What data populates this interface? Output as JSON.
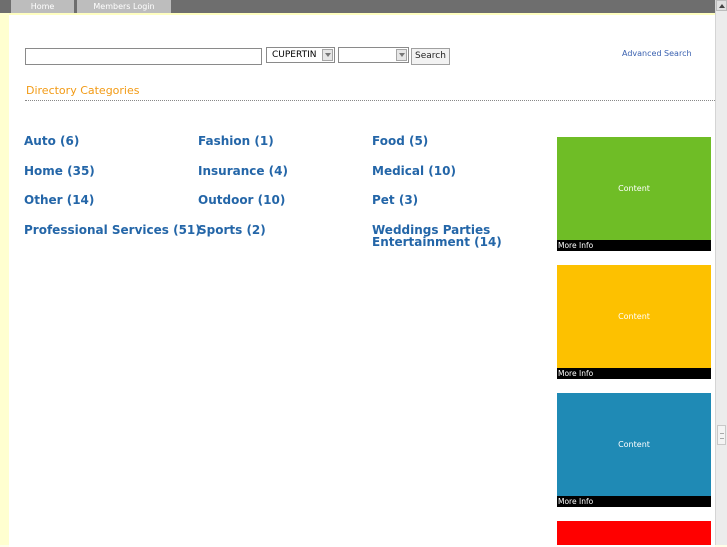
{
  "nav": {
    "tabs": [
      {
        "label": "Home"
      },
      {
        "label": "Members Login"
      }
    ]
  },
  "search": {
    "keyword_value": "",
    "city_value": "CUPERTIN",
    "category_value": "",
    "button_label": "Search",
    "advanced_label": "Advanced Search"
  },
  "directory": {
    "heading": "Directory Categories",
    "categories": [
      {
        "label": "Auto (6)"
      },
      {
        "label": "Fashion (1)"
      },
      {
        "label": "Food (5)"
      },
      {
        "label": "Home (35)"
      },
      {
        "label": "Insurance (4)"
      },
      {
        "label": "Medical (10)"
      },
      {
        "label": "Other (14)"
      },
      {
        "label": "Outdoor (10)"
      },
      {
        "label": "Pet (3)"
      },
      {
        "label": "Professional Services (51)"
      },
      {
        "label": "Sports (2)"
      },
      {
        "label": "Weddings Parties"
      },
      {
        "label": "Entertainment (14)"
      }
    ]
  },
  "ads": [
    {
      "content": "Content",
      "more": "More Info",
      "color": "#6fbd26"
    },
    {
      "content": "Content",
      "more": "More Info",
      "color": "#fdc100"
    },
    {
      "content": "Content",
      "more": "More Info",
      "color": "#1f8ab5"
    },
    {
      "color": "#ff0000"
    }
  ]
}
